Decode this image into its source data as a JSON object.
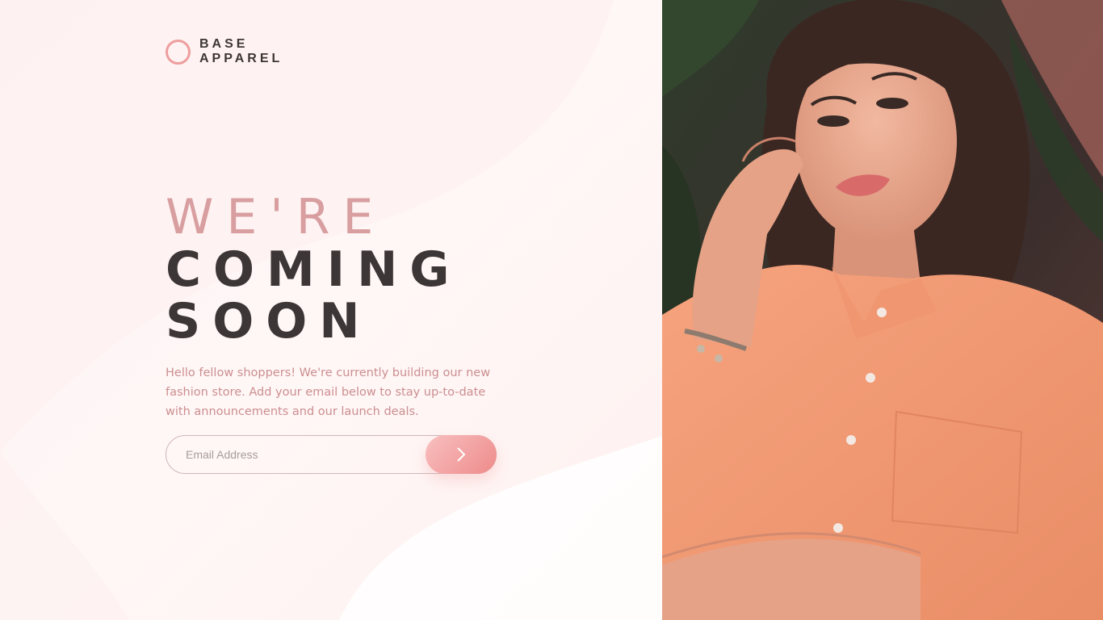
{
  "brand": {
    "line1": "BASE",
    "line2": "APPAREL",
    "accent_color": "#ee9d9e"
  },
  "hero": {
    "line1": "WE'RE",
    "line2": "COMING",
    "line3": "SOON",
    "light_color": "#d69a9c",
    "dark_color": "#3d3636"
  },
  "description": "Hello fellow shoppers! We're currently building our new fashion store. Add your email below to stay up-to-date with announcements and our launch deals.",
  "form": {
    "email_placeholder": "Email Address",
    "email_value": "",
    "submit_icon": "chevron-right-icon"
  },
  "hero_image": {
    "icon": "hero-photo",
    "subject": "woman in orange shirt"
  }
}
